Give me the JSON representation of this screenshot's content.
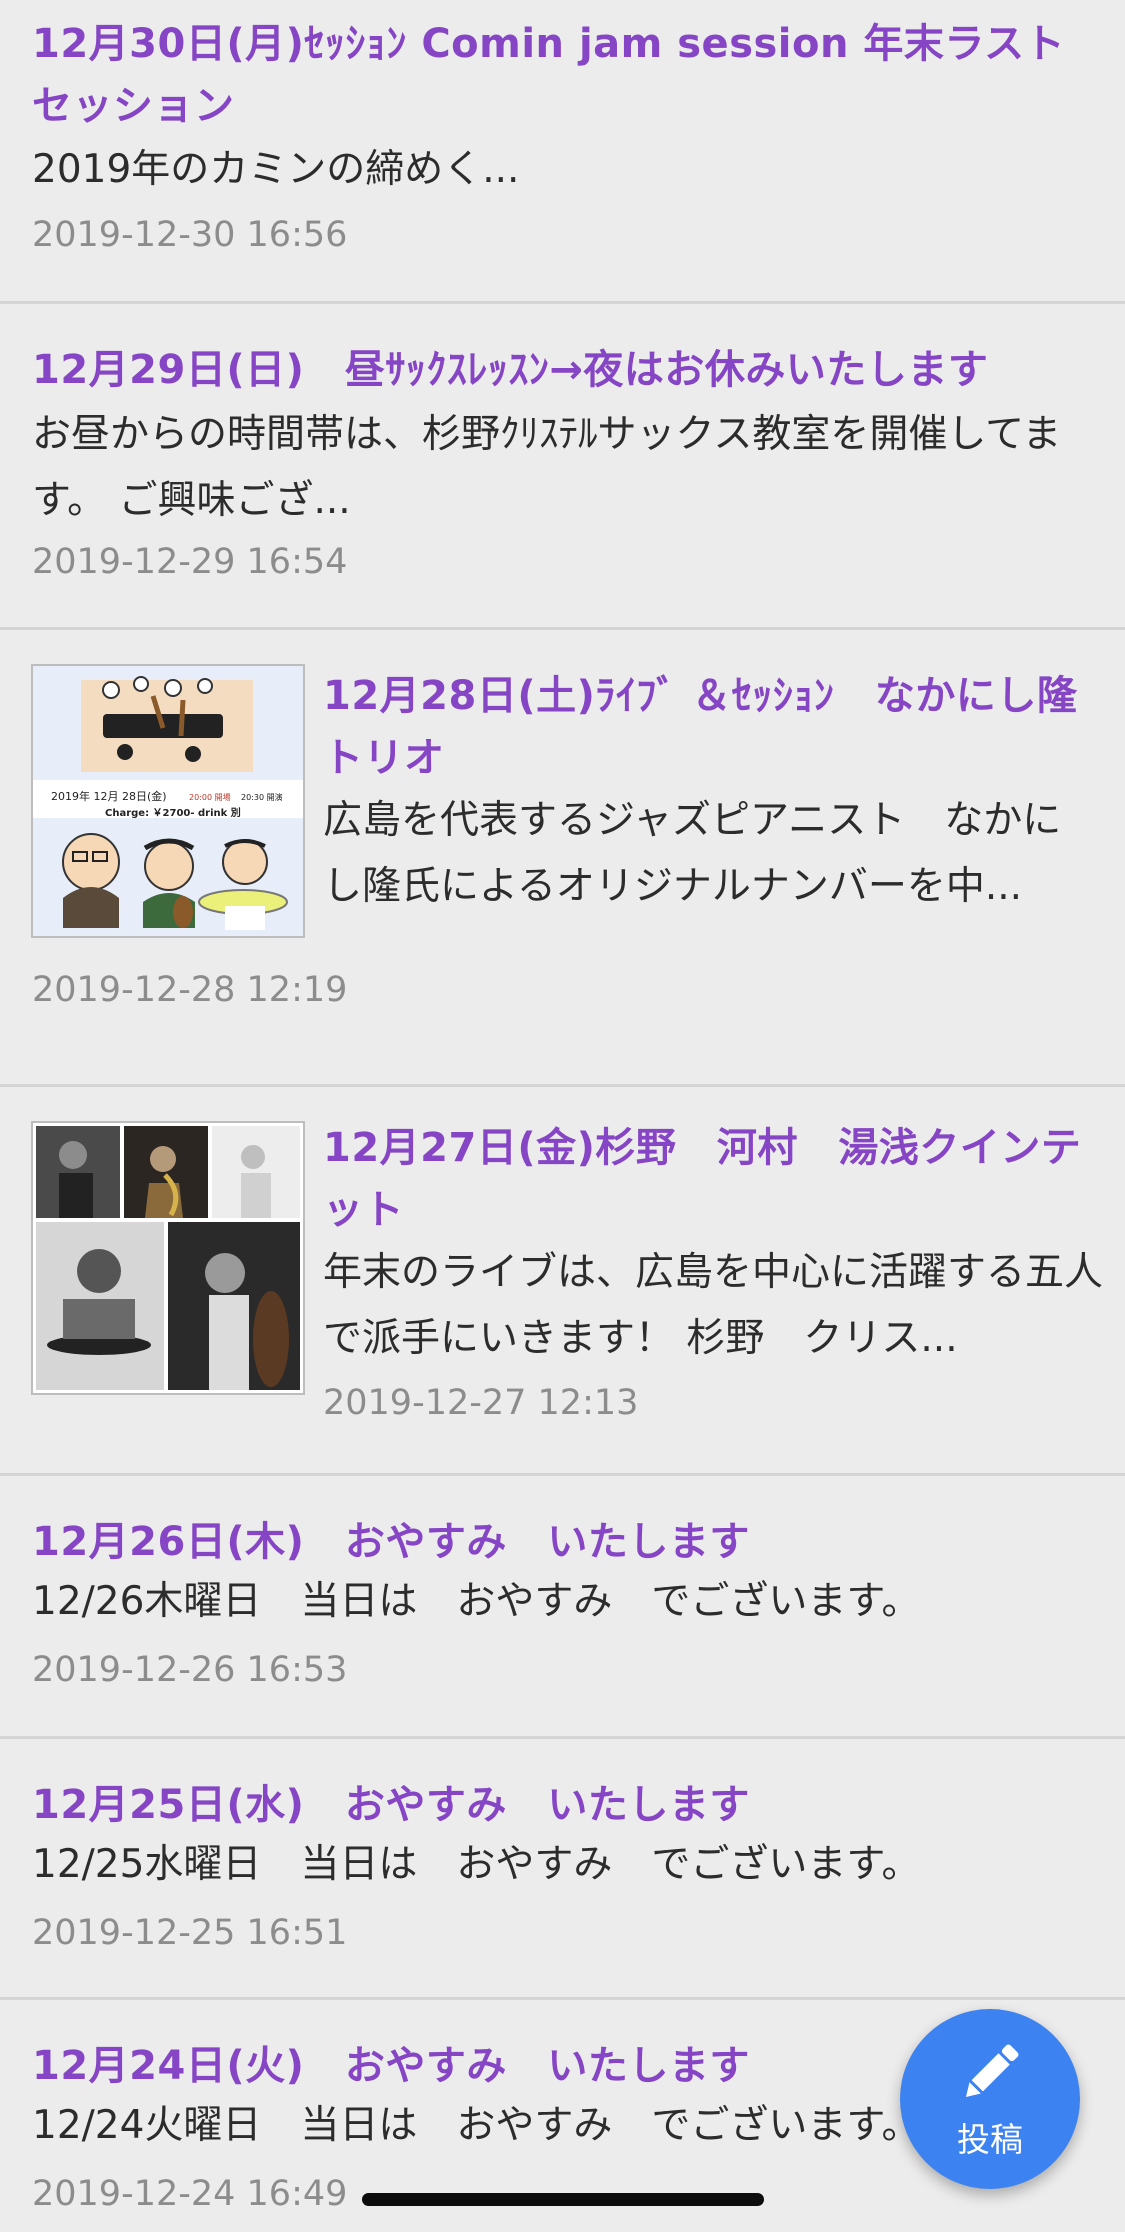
{
  "posts": [
    {
      "title": "12月30日(月)ｾｯｼｮﾝ Comin jam session 年末ラストセッション",
      "excerpt": "2019年のカミンの締めく...",
      "date": "2019-12-30 16:56"
    },
    {
      "title": "12月29日(日)　昼ｻｯｸｽﾚｯｽﾝ→夜はお休みいたします",
      "excerpt": "お昼からの時間帯は、杉野ｸﾘｽﾃﾙサックス教室を開催してます。 ご興味ござ...",
      "date": "2019-12-29 16:54"
    },
    {
      "title": "12月28日(土)ﾗｲﾌﾞ ＆ｾｯｼｮﾝ　なかにし隆トリオ",
      "excerpt": "広島を代表するジャズピアニスト　なかにし隆氏によるオリジナルナンバーを中...",
      "date": "2019-12-28 12:19",
      "thumbnail": {
        "date_line": "2019年 12月 28日(金)",
        "time_open": "20:00 開場",
        "time_start": "20:30 開演",
        "charge": "Charge: ￥2700- drink 別"
      }
    },
    {
      "title": "12月27日(金)杉野　河村　湯浅クインテット",
      "excerpt": "年末のライブは、広島を中心に活躍する五人で派手にいきます！ 杉野　クリス...",
      "date": "2019-12-27 12:13"
    },
    {
      "title": "12月26日(木)　おやすみ　いたします",
      "excerpt": "12/26木曜日　当日は　おやすみ　でございます。",
      "date": "2019-12-26 16:53"
    },
    {
      "title": "12月25日(水)　おやすみ　いたします",
      "excerpt": "12/25水曜日　当日は　おやすみ　でございます。",
      "date": "2019-12-25 16:51"
    },
    {
      "title": "12月24日(火)　おやすみ　いたします",
      "excerpt": "12/24火曜日　当日は　おやすみ　でございます。",
      "date": "2019-12-24 16:49"
    }
  ],
  "fab": {
    "label": "投稿",
    "icon": "pencil-icon",
    "color": "#3c82f0"
  },
  "colors": {
    "title": "#8545c4",
    "background": "#ececec"
  }
}
